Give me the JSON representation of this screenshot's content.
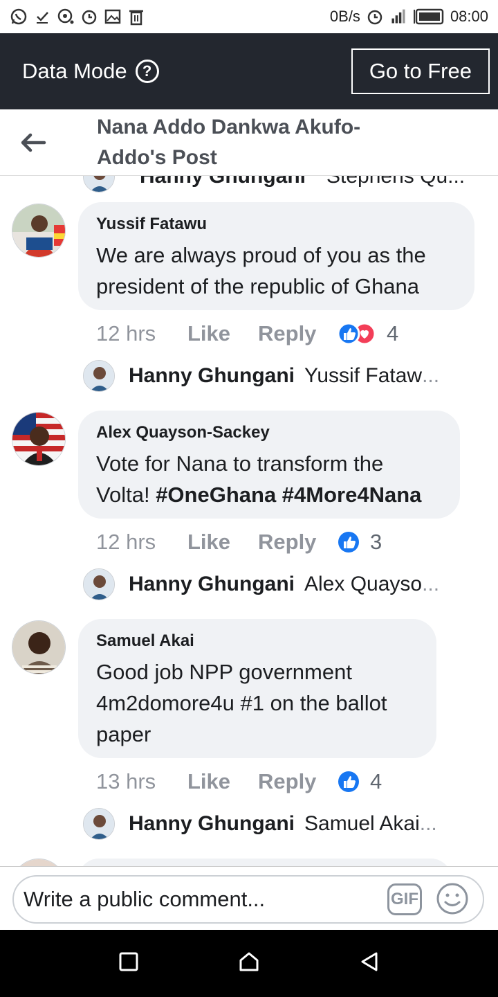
{
  "status_bar": {
    "left_icons": [
      "whatsapp-icon",
      "check-icon",
      "chat-icon",
      "alarm-icon",
      "image-icon",
      "trash-icon"
    ],
    "net_speed": "0B/s",
    "time": "08:00",
    "right_icons": [
      "alarm-icon",
      "signal-icon",
      "battery-icon"
    ]
  },
  "data_mode": {
    "label": "Data Mode",
    "help_glyph": "?",
    "go_free_label": "Go to Free"
  },
  "header": {
    "title": "Nana Addo Dankwa Akufo-Addo's Post"
  },
  "cut_reply": {
    "name": "Hanny Ghungani",
    "preview": "Stephens Qu..."
  },
  "comments": [
    {
      "author": "Yussif Fatawu",
      "text": "We are always proud of you as the president of the republic of Ghana",
      "time": "12 hrs",
      "like": "Like",
      "reply": "Reply",
      "reaction_count": "4",
      "reply_name": "Hanny Ghungani",
      "reply_preview": "Yussif Fataw",
      "ellipsis": "..."
    },
    {
      "author": "Alex Quayson-Sackey",
      "text_plain": "Vote for Nana to transform the Volta!",
      "hashtags": "#OneGhana #4More4Nana",
      "time": "12 hrs",
      "like": "Like",
      "reply": "Reply",
      "reaction_count": "3",
      "reply_name": "Hanny Ghungani",
      "reply_preview": "Alex Quayso",
      "ellipsis": "..."
    },
    {
      "author": "Samuel Akai",
      "text": "Good job NPP government 4m2domore4u #1 on the ballot paper",
      "time": "13 hrs",
      "like": "Like",
      "reply": "Reply",
      "reaction_count": "4",
      "reply_name": "Hanny Ghungani",
      "reply_preview": "Samuel Akai",
      "ellipsis": "..."
    }
  ],
  "composer": {
    "placeholder": "Write a public comment...",
    "gif_label": "GIF"
  },
  "colors": {
    "data_bar_bg": "#23272f",
    "like_blue": "#1877f2",
    "love_red": "#f33e58",
    "bubble_bg": "#f0f2f5"
  }
}
